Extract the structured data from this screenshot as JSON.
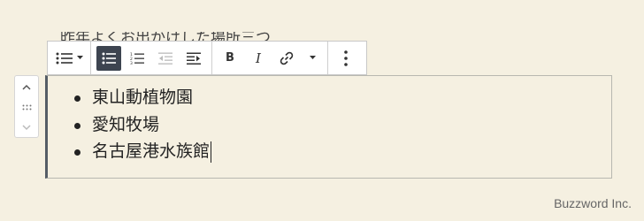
{
  "background_paragraph": "昨年よくお出かけした場所三つ",
  "list": {
    "items": [
      "東山動植物園",
      "愛知牧場",
      "名古屋港水族館"
    ]
  },
  "credit": "Buzzword Inc.",
  "toolbar": {
    "icons": [
      "list-block-icon",
      "dropdown-caret-icon",
      "unordered-list-icon",
      "ordered-list-icon",
      "outdent-icon",
      "indent-icon",
      "bold-icon",
      "italic-icon",
      "link-icon",
      "more-caret-icon",
      "more-options-icon"
    ],
    "bold_glyph": "B",
    "italic_glyph": "I"
  },
  "colors": {
    "page_bg": "#f5f0e1",
    "active_button": "#3d4450",
    "block_accent": "#555d66"
  }
}
